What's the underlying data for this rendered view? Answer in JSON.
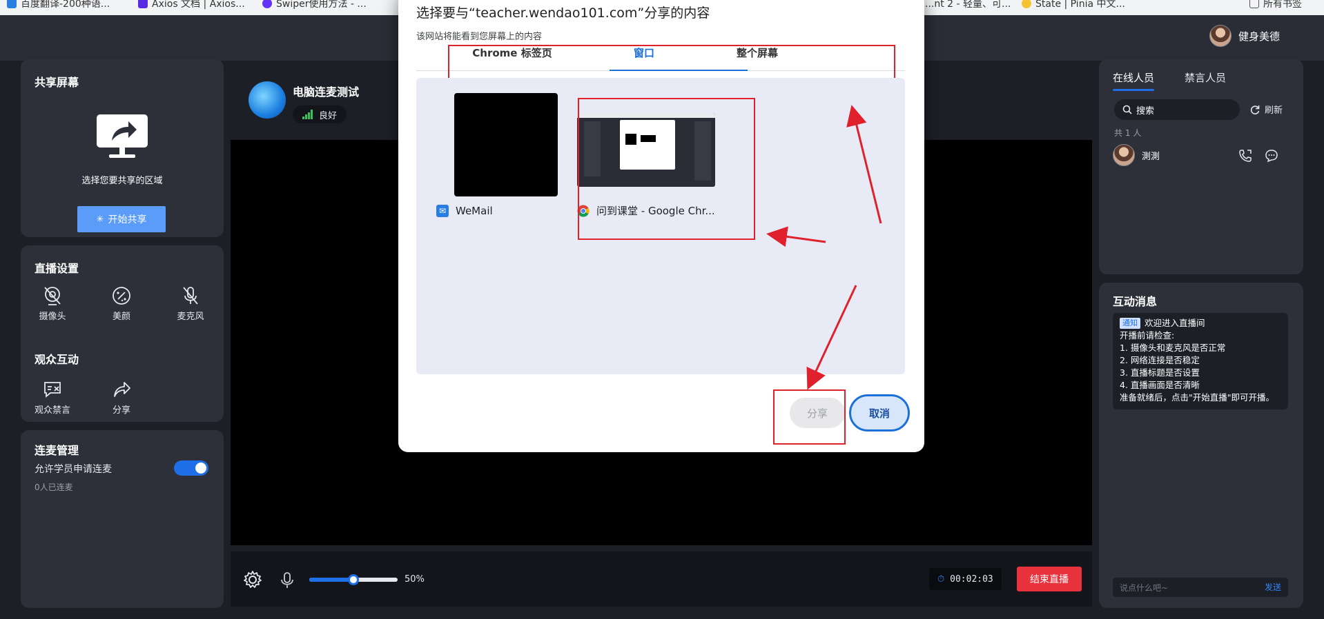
{
  "bookmarks": [
    "百度翻译-200种语...",
    "Axios 文档 | Axios...",
    "Swiper使用方法 - ...",
    "...nt 2 - 轻量、可...",
    "State | Pinia 中文...",
    "所有书签"
  ],
  "header": {
    "username": "健身美德"
  },
  "share_panel": {
    "title": "共享屏幕",
    "hint": "选择您要共享的区域",
    "start_button": "开始共享"
  },
  "live_settings": {
    "title": "直播设置",
    "tools": [
      "摄像头",
      "美颜",
      "麦克风"
    ],
    "interaction_title": "观众互动",
    "interaction_tools": [
      "观众禁言",
      "分享"
    ]
  },
  "link_management": {
    "title": "连麦管理",
    "toggle_label": "允许学员申请连麦",
    "toggle_on": true,
    "status": "0人已连麦"
  },
  "room": {
    "title": "电脑连麦测试",
    "signal": "良好"
  },
  "controls": {
    "volume_percent": 50,
    "volume_text": "50%",
    "timer": "00:02:03",
    "end_button": "结束直播"
  },
  "online_panel": {
    "tabs": [
      "在线人员",
      "禁言人员"
    ],
    "search_placeholder": "搜索",
    "refresh": "刷新",
    "count": "共 1 人",
    "members": [
      {
        "name": "測測"
      }
    ]
  },
  "messages_panel": {
    "title": "互动消息",
    "notice_tag": "通知",
    "notice_text": "欢迎进入直播间",
    "lines": [
      "开播前请检查:",
      "1. 摄像头和麦克风是否正常",
      "2. 网络连接是否稳定",
      "3. 直播标题是否设置",
      "4. 直播画面是否清晰",
      "准备就绪后，点击\"开始直播\"即可开播。"
    ],
    "input_placeholder": "说点什么吧~",
    "send": "发送"
  },
  "share_dialog": {
    "title": "选择要与“teacher.wendao101.com”分享的内容",
    "subtitle": "该网站将能看到您屏幕上的内容",
    "tabs": [
      "Chrome 标签页",
      "窗口",
      "整个屏幕"
    ],
    "active_tab": "窗口",
    "sources": [
      {
        "label": "WeMail",
        "icon": "mail-icon"
      },
      {
        "label": "问到课堂 - Google Chr...",
        "icon": "chrome-icon"
      }
    ],
    "share_button": "分享",
    "cancel_button": "取消"
  },
  "colors": {
    "accent": "#1e6fe8",
    "end_red": "#e8323c",
    "annotation_red": "#e0202a"
  }
}
